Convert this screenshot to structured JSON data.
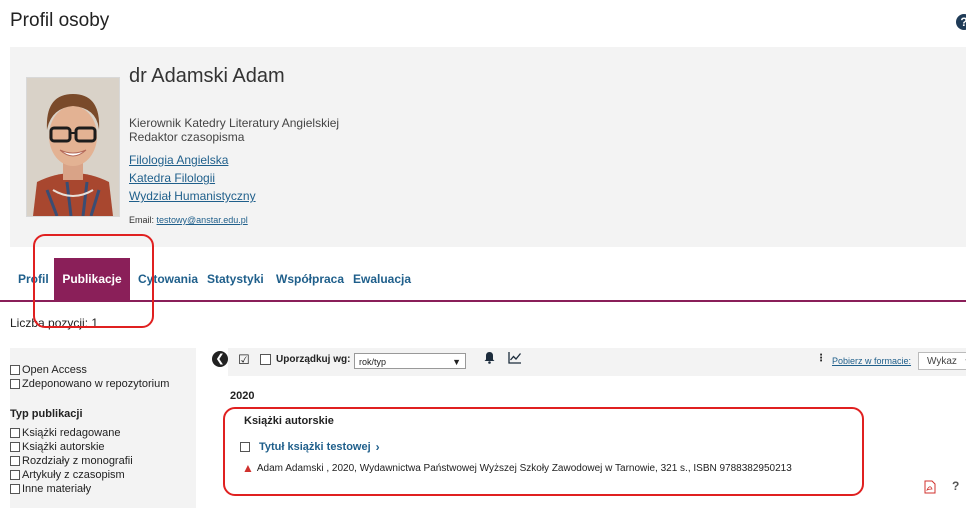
{
  "page": {
    "title": "Profil osoby",
    "help_label": "?"
  },
  "profile": {
    "name": "dr Adamski Adam",
    "roles": [
      "Kierownik Katedry Literatury Angielskiej",
      "Redaktor czasopisma"
    ],
    "units": [
      "Filologia Angielska",
      "Katedra Filologii",
      "Wydział Humanistyczny"
    ],
    "email_label": "Email:",
    "email": "testowy@anstar.edu.pl"
  },
  "tabs": [
    {
      "label": "Profil",
      "active": false
    },
    {
      "label": "Publikacje",
      "active": true
    },
    {
      "label": "Cytowania",
      "active": false
    },
    {
      "label": "Statystyki",
      "active": false
    },
    {
      "label": "Współpraca",
      "active": false
    },
    {
      "label": "Ewaluacja",
      "active": false
    }
  ],
  "results": {
    "count_label": "Liczba pozycji: 1"
  },
  "filters": {
    "access": [
      "Open Access",
      "Zdeponowano w repozytorium"
    ],
    "type_heading": "Typ publikacji",
    "types": [
      "Książki redagowane",
      "Książki autorskie",
      "Rozdziały z monografii",
      "Artykuły z czasopism",
      "Inne materiały"
    ]
  },
  "toolbar": {
    "collapse_icon": "chevron-left-icon",
    "sort_label": "Uporządkuj wg:",
    "sort_value": "rok/typ",
    "download_label": "Pobierz w formacie:",
    "format_value": "Wykaz"
  },
  "publications": {
    "year": "2020",
    "group": "Książki autorskie",
    "items": [
      {
        "title": "Tytuł książki testowej",
        "citation": "Adam Adamski , 2020, Wydawnictwa Państwowej Wyższej Szkoły Zawodowej w Tarnowie, 321 s., ISBN 9788382950213"
      }
    ]
  },
  "colors": {
    "accent": "#8a1f59",
    "link": "#1f5f8b",
    "highlight": "#e02020"
  }
}
